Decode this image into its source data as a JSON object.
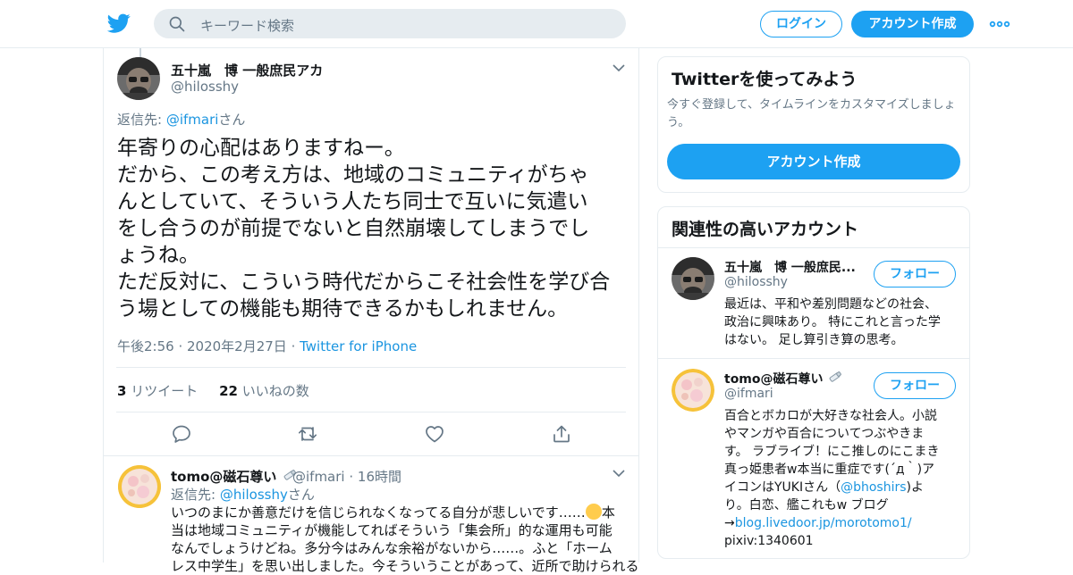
{
  "header": {
    "search_placeholder": "キーワード検索",
    "login_label": "ログイン",
    "signup_label": "アカウント作成"
  },
  "tweet": {
    "author_name": "五十嵐　博 一般庶民アカ",
    "author_handle": "@hilosshy",
    "reply_prefix": "返信先: ",
    "reply_to": "@ifmari",
    "reply_suffix": "さん",
    "text_lines": [
      "年寄りの心配はありますねー。",
      "だから、この考え方は、地域のコミュニティがちゃ",
      "んとしていて、そういう人たち同士で互いに気遣い",
      "をし合うのが前提でないと自然崩壊してしまうでし",
      "ょうね。",
      "ただ反対に、こういう時代だからこそ社会性を学び合",
      "う場としての機能も期待できるかもしれません。"
    ],
    "timestamp": "午後2:56 · 2020年2月27日",
    "separator": " · ",
    "source": "Twitter for iPhone",
    "retweet_count": "3",
    "retweet_label": " リツイート",
    "like_count": "22",
    "like_label": " いいねの数"
  },
  "reply": {
    "author_name": "tomo@磁石尊い",
    "author_handle": "@ifmari",
    "time": "16時間",
    "time_sep": " · ",
    "reply_prefix": "返信先: ",
    "reply_to": "@hilosshy",
    "reply_suffix": "さん",
    "line1": "いつのまにか善意だけを信じられなくなってる自分が悲しいです……",
    "line1_after": "本",
    "line2": "当は地域コミュニティが機能してればそういう「集会所」的な運用も可能",
    "line3": "なんでしょうけどね。多分今はみんな余裕がないから……。ふと「ホーム",
    "line4": "レス中学生」を思い出しました。今そういうことがあって、近所で助けられる"
  },
  "signup_card": {
    "title": "Twitterを使ってみよう",
    "desc": "今すぐ登録して、タイムラインをカスタマイズしましょう。",
    "button": "アカウント作成"
  },
  "related": {
    "title": "関連性の高いアカウント",
    "follow_label": "フォロー",
    "accounts": [
      {
        "name": "五十嵐　博 一般庶民...",
        "handle": "@hilosshy",
        "bio_lines": [
          "最近は、平和や差別問題などの社会、",
          "政治に興味あり。 特にこれと言った学",
          "はない。 足し算引き算の思考。"
        ]
      },
      {
        "name": "tomo@磁石尊い",
        "handle": "@ifmari",
        "bio_lines": [
          "百合とボカロが大好きな社会人。小説",
          "やマンガや百合についてつぶやきま",
          "す。 ラブライブ！にこ推しのにこまき",
          "真っ姫患者w本当に重症です(´д｀)ア"
        ],
        "bio_line5_pre": "イコンはYUKIさん（",
        "bio_line5_link": "@bhoshirs",
        "bio_line5_post": ")よ",
        "bio_line6": "り。白恋、艦これもw ブログ",
        "bio_line7_pre": "→",
        "bio_line7_link": "blog.livedoor.jp/morotomo1/",
        "bio_line8": "pixiv:1340601"
      }
    ]
  },
  "colors": {
    "brand": "#1da1f2",
    "link": "#1b95e0",
    "muted": "#657786"
  },
  "icons": [
    "twitter-bird-icon",
    "search-icon",
    "more-dots-icon",
    "chevron-down-icon",
    "reply-icon",
    "retweet-icon",
    "like-icon",
    "share-icon",
    "medical-tool-icon"
  ]
}
